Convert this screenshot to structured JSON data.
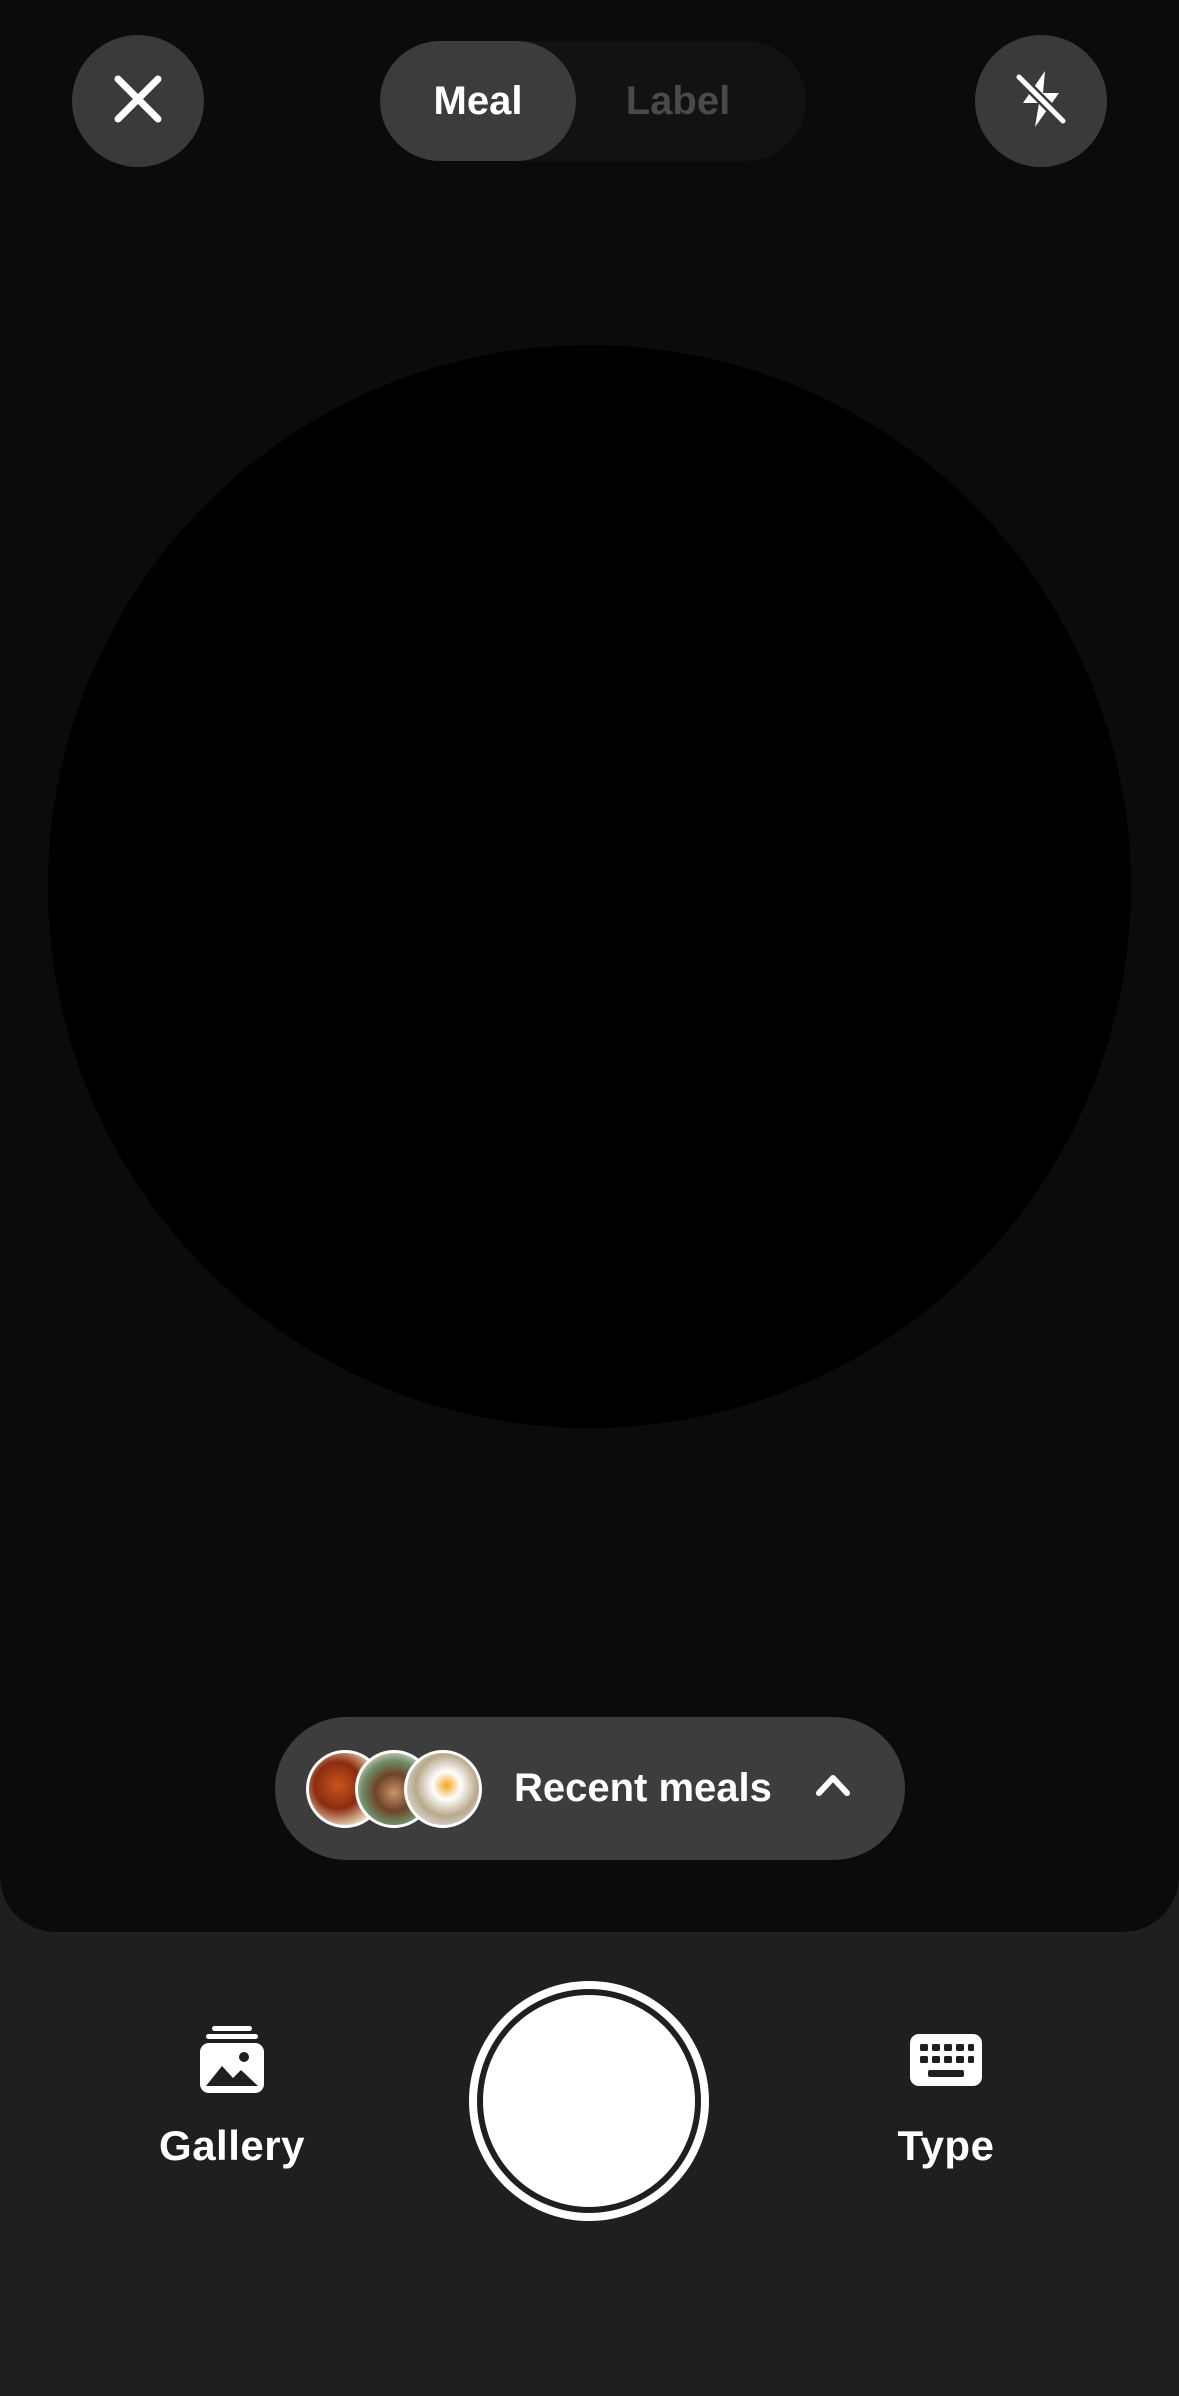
{
  "mode_toggle": {
    "options": [
      "Meal",
      "Label"
    ],
    "selected": "Meal"
  },
  "top_bar": {
    "close_icon": "close-icon",
    "flash_icon": "flash-off-icon"
  },
  "recent_meals": {
    "label": "Recent meals",
    "thumbnails": [
      "pasta-dish",
      "latte-cup",
      "egg-toast"
    ],
    "chevron_icon": "chevron-up-icon"
  },
  "bottom_bar": {
    "gallery_label": "Gallery",
    "gallery_icon": "gallery-icon",
    "type_label": "Type",
    "type_icon": "keyboard-icon",
    "shutter_icon": "shutter-button"
  },
  "colors": {
    "background": "#1f1f1f",
    "viewfinder": "#0b0b0b",
    "accent": "#ffffff",
    "pill": "#3c3c3c"
  }
}
